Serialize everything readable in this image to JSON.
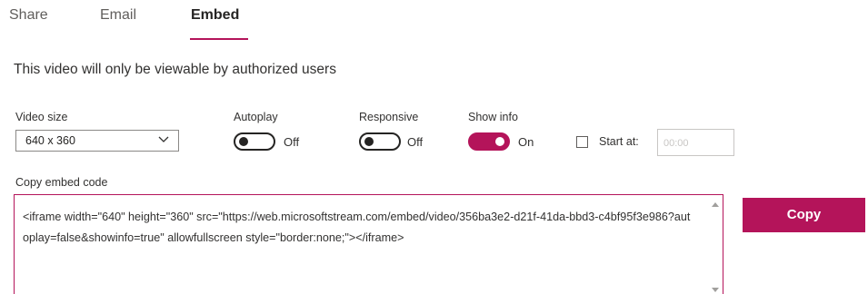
{
  "tabs": [
    {
      "label": "Share",
      "active": false
    },
    {
      "label": "Email",
      "active": false
    },
    {
      "label": "Embed",
      "active": true
    }
  ],
  "notice": "This video will only be viewable by authorized users",
  "video_size": {
    "label": "Video size",
    "selected": "640 x 360"
  },
  "autoplay": {
    "label": "Autoplay",
    "state": "Off",
    "on": false
  },
  "responsive": {
    "label": "Responsive",
    "state": "Off",
    "on": false
  },
  "show_info": {
    "label": "Show info",
    "state": "On",
    "on": true
  },
  "start_at": {
    "label": "Start at:",
    "placeholder": "00:00",
    "checked": false
  },
  "embed": {
    "label": "Copy embed code",
    "code": "<iframe width=\"640\" height=\"360\" src=\"https://web.microsoftstream.com/embed/video/356ba3e2-d21f-41da-bbd3-c4bf95f3e986?autoplay=false&showinfo=true\" allowfullscreen style=\"border:none;\"></iframe>"
  },
  "copy_button": "Copy",
  "colors": {
    "accent": "#b4145a",
    "text": "#323130",
    "muted": "#605e5c"
  }
}
